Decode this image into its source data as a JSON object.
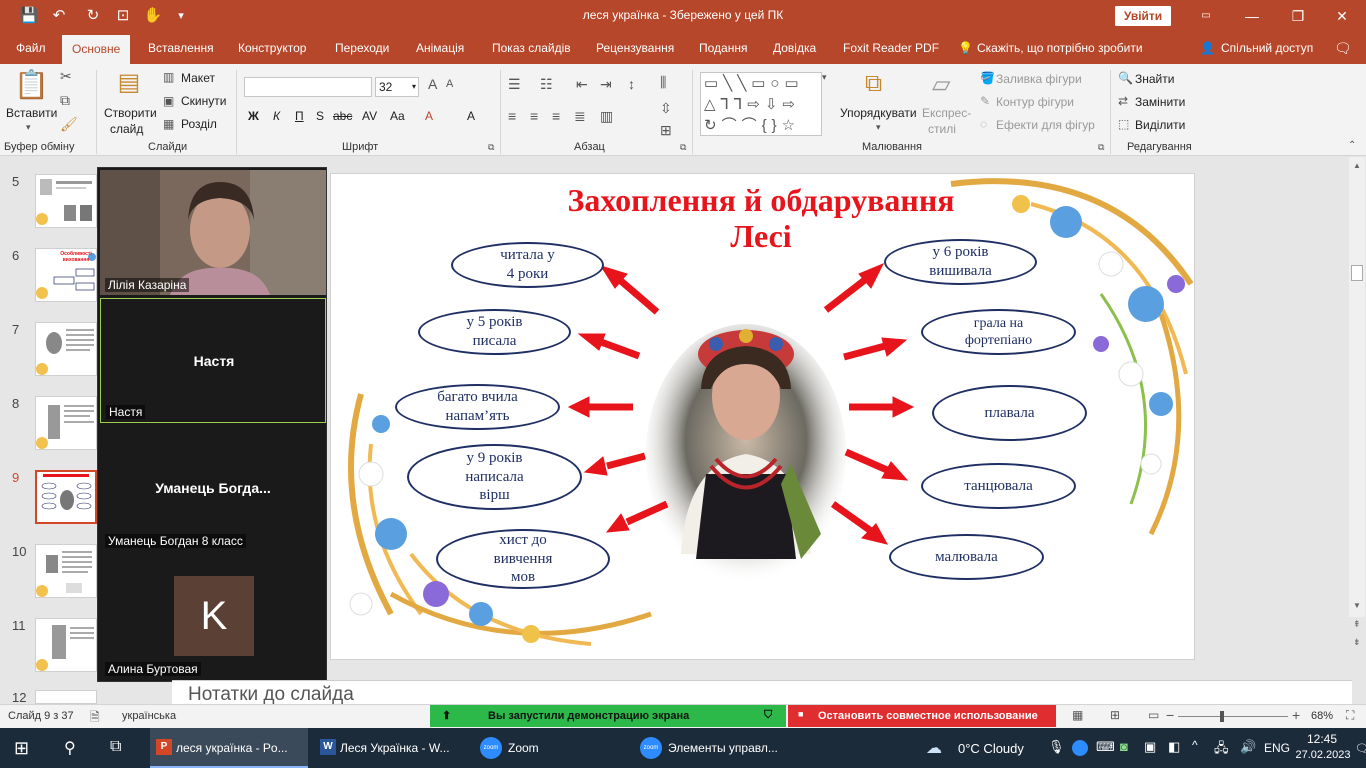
{
  "window": {
    "title": "леся українка  -  Збережено у цей ПК",
    "signin": "Увійти",
    "minimize": "—",
    "restore": "❐",
    "close": "✕"
  },
  "quick_access": [
    "💾",
    "↶",
    "↻",
    "⊡",
    "✋",
    "▾"
  ],
  "tabs": {
    "file": "Файл",
    "home": "Основне",
    "insert": "Вставлення",
    "design": "Конструктор",
    "transitions": "Переходи",
    "animation": "Анімація",
    "slideshow": "Показ слайдів",
    "review": "Рецензування",
    "view": "Подання",
    "help": "Довідка",
    "foxit": "Foxit Reader PDF",
    "tellme": "Скажіть, що потрібно зробити",
    "share": "Спільний доступ"
  },
  "ribbon": {
    "clipboard": {
      "paste": "Вставити",
      "label": "Буфер обміну"
    },
    "slides": {
      "new_slide_1": "Створити",
      "new_slide_2": "слайд",
      "layout": "Макет",
      "reset": "Скинути",
      "section": "Розділ",
      "label": "Слайди"
    },
    "font": {
      "font_name": "",
      "font_size": "32",
      "bold": "Ж",
      "italic": "К",
      "underline": "П",
      "strike": "abc",
      "shadow": "S",
      "spacing": "AV",
      "case": "Aa",
      "clear": "A",
      "color": "A",
      "label": "Шрифт"
    },
    "paragraph": {
      "label": "Абзац"
    },
    "drawing": {
      "arrange_1": "Упорядкувати",
      "quick_styles_1": "Експрес-",
      "quick_styles_2": "стилі",
      "fill": "Заливка фігури",
      "outline": "Контур фігури",
      "effects": "Ефекти для фігур",
      "label": "Малювання"
    },
    "editing": {
      "find": "Знайти",
      "replace": "Замінити",
      "select": "Виділити",
      "label": "Редагування"
    }
  },
  "thumbnails": [
    {
      "num": "5",
      "selected": false
    },
    {
      "num": "6",
      "selected": false
    },
    {
      "num": "7",
      "selected": false
    },
    {
      "num": "8",
      "selected": false
    },
    {
      "num": "9",
      "selected": true
    },
    {
      "num": "10",
      "selected": false
    },
    {
      "num": "11",
      "selected": false
    },
    {
      "num": "12",
      "selected": false
    }
  ],
  "thumb6_title": "Особливості виховання",
  "slide": {
    "title_line1": "Захоплення й обдарування",
    "title_line2": "Лесі",
    "left_items": [
      {
        "l1": "читала у",
        "l2": "4 роки",
        "l3": ""
      },
      {
        "l1": "у 5 років",
        "l2": "писала",
        "l3": ""
      },
      {
        "l1": "багато вчила",
        "l2": "напам’ять",
        "l3": ""
      },
      {
        "l1": "у 9 років",
        "l2": "написала",
        "l3": "вірш"
      },
      {
        "l1": "хист до",
        "l2": "вивчення",
        "l3": "мов"
      }
    ],
    "right_items": [
      {
        "l1": "у 6 років",
        "l2": "вишивала"
      },
      {
        "l1": "грала на",
        "l2": "фортепіано"
      },
      {
        "l1": "плавала",
        "l2": ""
      },
      {
        "l1": "танцювала",
        "l2": ""
      },
      {
        "l1": "малювала",
        "l2": ""
      }
    ],
    "accent_color": "#e8141b",
    "oval_color": "#1f2f64"
  },
  "zoom": {
    "participants": [
      {
        "name": "Лілія Казаріна",
        "display": "",
        "video": true
      },
      {
        "name": "Настя",
        "display": "Настя",
        "video": false
      },
      {
        "name": "Уманець Богдан 8 класс",
        "display": "Уманець  Богда...",
        "video": false
      },
      {
        "name": "Алина Буртовая",
        "display": "",
        "avatar_letter": "K",
        "video": false
      }
    ],
    "sharing_banner": "Вы запустили демонстрацию экрана",
    "stop_sharing": "Остановить совместное использование"
  },
  "notes_placeholder": "Нотатки до слайда",
  "status": {
    "slide_info": "Слайд 9 з 37",
    "language": "українська",
    "zoom_level": "68%",
    "zoom_minus": "−",
    "zoom_plus": "+"
  },
  "taskbar": {
    "apps": [
      {
        "label": "леся українка - Po...",
        "icon": "powerpoint-icon"
      },
      {
        "label": "Леся Українка - W...",
        "icon": "word-icon"
      },
      {
        "label": "Zoom",
        "icon": "zoom-icon"
      },
      {
        "label": "Элементы управл...",
        "icon": "zoom-icon"
      }
    ],
    "weather": "0°C  Cloudy",
    "lang": "ENG",
    "time": "12:45",
    "date": "27.02.2023"
  }
}
